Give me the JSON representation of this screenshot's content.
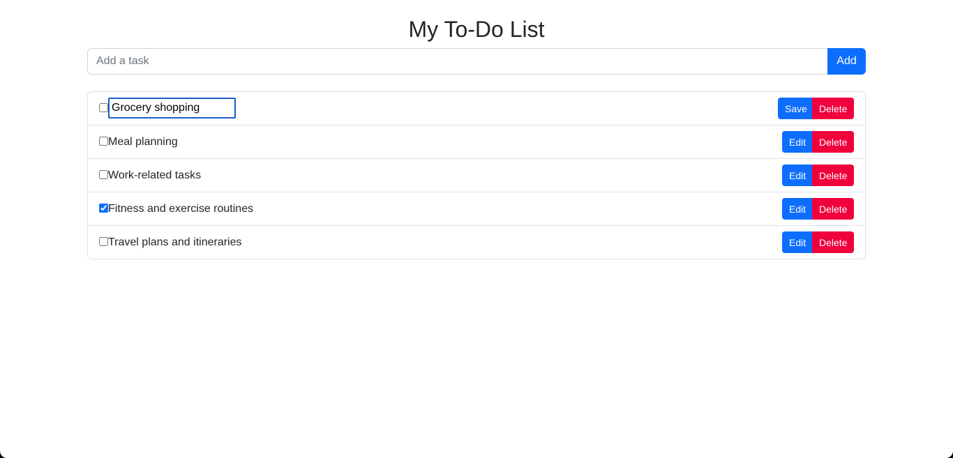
{
  "page": {
    "title": "My To-Do List"
  },
  "add_task": {
    "placeholder": "Add a task",
    "value": "",
    "button_label": "Add"
  },
  "tasks": [
    {
      "text": "Grocery shopping",
      "checked": false,
      "editing": true,
      "primary_label": "Save",
      "delete_label": "Delete"
    },
    {
      "text": "Meal planning",
      "checked": false,
      "editing": false,
      "primary_label": "Edit",
      "delete_label": "Delete"
    },
    {
      "text": "Work-related tasks",
      "checked": false,
      "editing": false,
      "primary_label": "Edit",
      "delete_label": "Delete"
    },
    {
      "text": "Fitness and exercise routines",
      "checked": true,
      "editing": false,
      "primary_label": "Edit",
      "delete_label": "Delete"
    },
    {
      "text": "Travel plans and itineraries",
      "checked": false,
      "editing": false,
      "primary_label": "Edit",
      "delete_label": "Delete"
    }
  ],
  "colors": {
    "primary": "#0d6efd",
    "danger": "#f0003c",
    "border": "#dee2e6",
    "text": "#212529"
  }
}
